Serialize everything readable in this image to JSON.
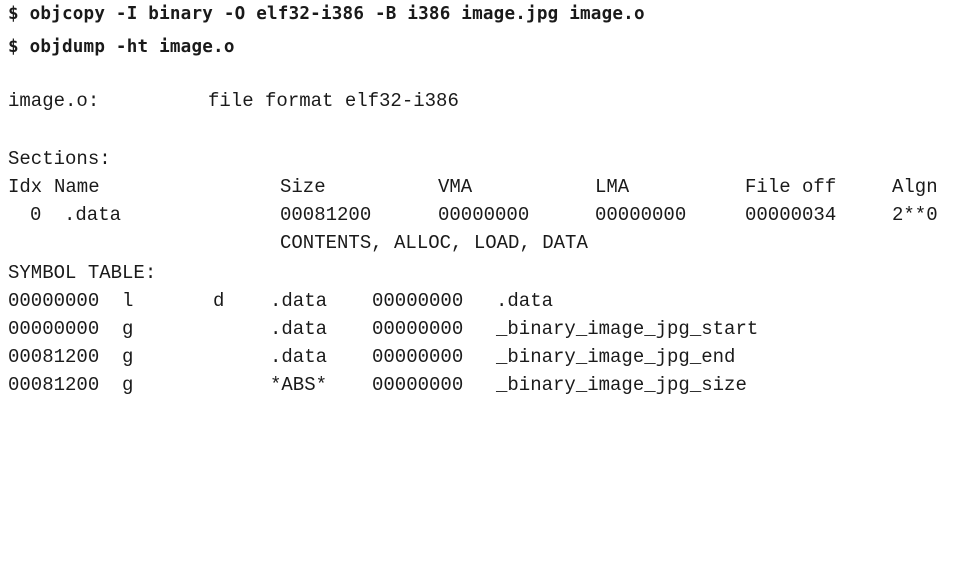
{
  "commands": [
    "$ objcopy -I binary -O elf32-i386 -B i386 image.jpg image.o",
    "$ objdump -ht image.o"
  ],
  "file_format": {
    "file": "image.o:",
    "format": "file format elf32-i386"
  },
  "sections": {
    "title": "Sections:",
    "headers": [
      "Idx",
      "Name",
      "Size",
      "VMA",
      "LMA",
      "File off",
      "Algn"
    ],
    "rows": [
      {
        "idx": "0",
        "name": ".data",
        "size": "00081200",
        "vma": "00000000",
        "lma": "00000000",
        "file_off": "00000034",
        "algn": "2**0",
        "flags": "CONTENTS, ALLOC, LOAD, DATA"
      }
    ]
  },
  "symbol_table": {
    "title": "SYMBOL TABLE:",
    "rows": [
      {
        "value": "00000000",
        "flag": "l",
        "dflag": "d",
        "section": ".data",
        "size": "00000000",
        "name": ".data"
      },
      {
        "value": "00000000",
        "flag": "g",
        "dflag": "",
        "section": ".data",
        "size": "00000000",
        "name": "_binary_image_jpg_start"
      },
      {
        "value": "00081200",
        "flag": "g",
        "dflag": "",
        "section": ".data",
        "size": "00000000",
        "name": "_binary_image_jpg_end"
      },
      {
        "value": "00081200",
        "flag": "g",
        "dflag": "",
        "section": "*ABS*",
        "size": "00000000",
        "name": "_binary_image_jpg_size"
      }
    ]
  }
}
